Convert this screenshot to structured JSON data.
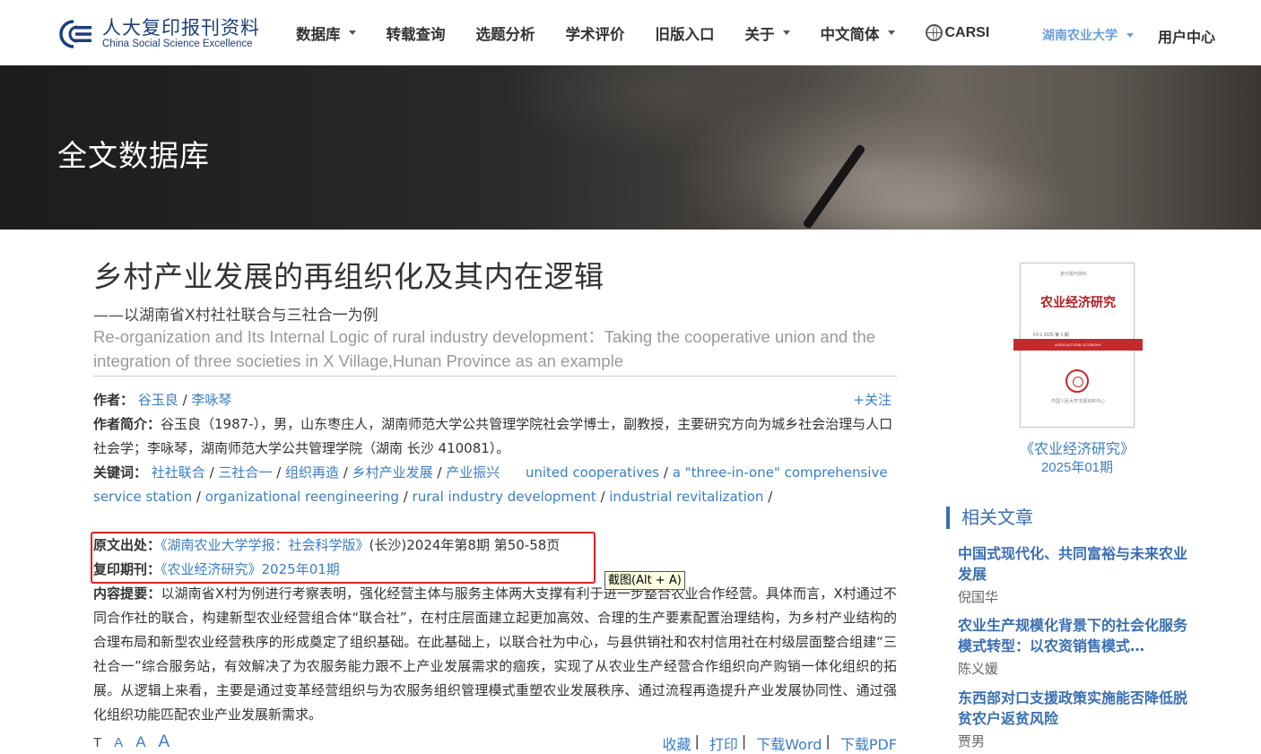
{
  "header": {
    "logo_cn": "人大复印报刊资料",
    "logo_en": "China Social Science Excellence",
    "nav": [
      {
        "label": "数据库",
        "dropdown": true
      },
      {
        "label": "转载查询",
        "dropdown": false
      },
      {
        "label": "选题分析",
        "dropdown": false
      },
      {
        "label": "学术评价",
        "dropdown": false
      },
      {
        "label": "旧版入口",
        "dropdown": false
      },
      {
        "label": "关于",
        "dropdown": true
      },
      {
        "label": "中文简体",
        "dropdown": true
      }
    ],
    "carsi": "CARSI",
    "university": "湖南农业大学",
    "user_center": "用户中心"
  },
  "banner": {
    "title": "全文数据库"
  },
  "article": {
    "title": "乡村产业发展的再组织化及其内在逻辑",
    "subtitle": "——以湖南省X村社社联合与三社合一为例",
    "title_en": "Re-organization and Its Internal Logic of rural industry development：Taking the cooperative union and the integration of three societies in X Village,Hunan Province as an example",
    "authors_label": "作者：",
    "authors": [
      "谷玉良",
      "李咏琴"
    ],
    "follow": "+关注",
    "intro_label": "作者简介：",
    "intro": "谷玉良（1987-），男，山东枣庄人，湖南师范大学公共管理学院社会学博士，副教授，主要研究方向为城乡社会治理与人口社会学；李咏琴，湖南师范大学公共管理学院（湖南 长沙 410081）。",
    "keywords_label": "关键词：",
    "keywords_cn": [
      "社社联合",
      "三社合一",
      "组织再造",
      "乡村产业发展",
      "产业振兴"
    ],
    "keywords_en": [
      "united cooperatives",
      "a \"three-in-one\" comprehensive service station",
      "organizational reengineering",
      "rural industry development",
      "industrial revitalization"
    ],
    "source_label": "原文出处：",
    "source_link": "《湖南农业大学学报：社会科学版》",
    "source_rest": "(长沙)2024年第8期 第50-58页",
    "reprint_label": "复印期刊：",
    "reprint_link": "《农业经济研究》2025年01期",
    "abstract_label": "内容提要：",
    "abstract": "以湖南省X村为例进行考察表明，强化经营主体与服务主体两大支撑有利于进一步整合农业合作经营。具体而言，X村通过不同合作社的联合，构建新型农业经营组合体“联合社”，在村庄层面建立起更加高效、合理的生产要素配置治理结构，为乡村产业结构的合理布局和新型农业经营秩序的形成奠定了组织基础。在此基础上，以联合社为中心，与县供销社和农村信用社在村级层面整合组建“三社合一”综合服务站，有效解决了为农服务能力跟不上产业发展需求的痼疾，实现了从农业生产经营合作组织向产购销一体化组织的拓展。从逻辑上来看，主要是通过变革经营组织与为农服务组织管理模式重塑农业发展秩序、通过流程再造提升产业发展协同性、通过强化组织功能匹配农业产业发展新需求。",
    "font_sizes": [
      "T",
      "A",
      "A",
      "A"
    ],
    "actions": [
      "收藏",
      "打印",
      "下载Word",
      "下载PDF"
    ],
    "tooltip": "截图(Alt + A)"
  },
  "sidebar": {
    "cover": {
      "top_small": "复印报刊资料",
      "name": "农业经济研究",
      "info": "F2-1 2025 第 1 期",
      "band": "AGRICULTURAL ECONOMY",
      "foot": "中国人民大学书报资料中心"
    },
    "journal_name": "《农业经济研究》",
    "journal_issue": "2025年01期",
    "related_title": "相关文章",
    "related": [
      {
        "title": "中国式现代化、共同富裕与未来农业发展",
        "author": "倪国华"
      },
      {
        "title": "农业生产规模化背景下的社会化服务模式转型：以农资销售模式…",
        "author": "陈义媛"
      },
      {
        "title": "东西部对口支援政策实施能否降低脱贫农户返贫风险",
        "author": "贾男"
      }
    ]
  },
  "colors": {
    "brand": "#1b3e7a",
    "link": "#3b7dc4",
    "highlight_box": "#e02020",
    "university": "#6aa0d8"
  }
}
